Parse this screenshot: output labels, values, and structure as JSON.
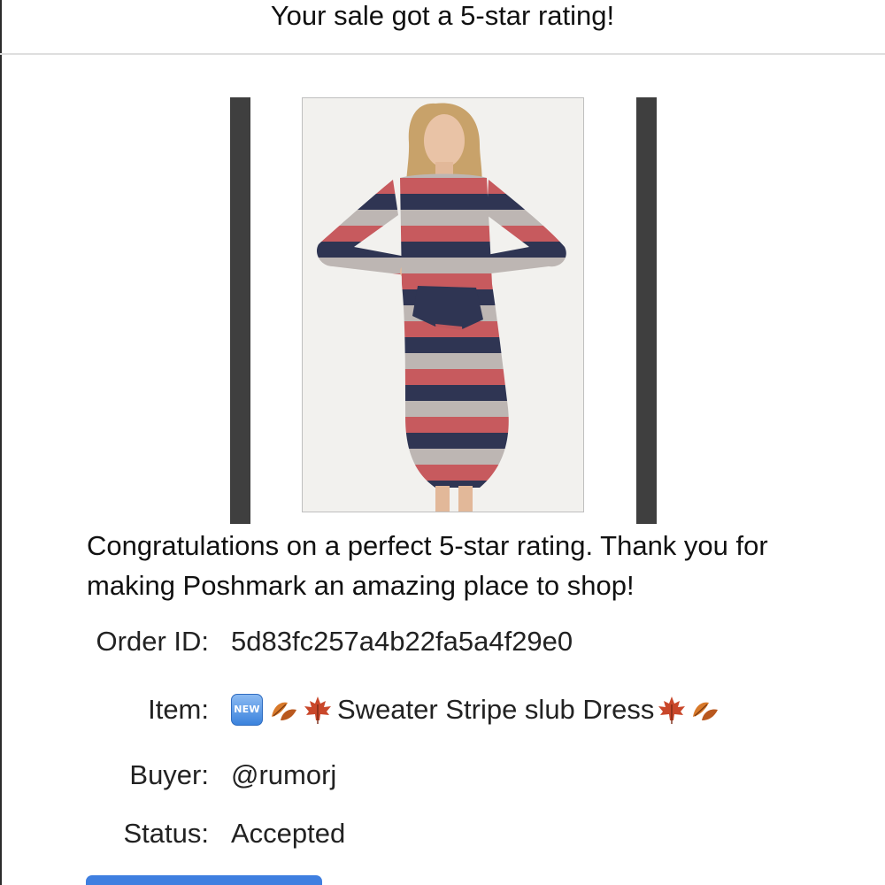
{
  "header": {
    "title": "Your sale got a 5-star rating!"
  },
  "product": {
    "image_icon": "striped-dress-photo"
  },
  "message": {
    "text": "Congratulations on a perfect 5-star rating. Thank you for making Poshmark an amazing place to shop!"
  },
  "details": {
    "order_label": "Order ID:",
    "order_value": "5d83fc257a4b22fa5a4f29e0",
    "item_label": "Item:",
    "item_badge": "NEW",
    "item_name": "Sweater Stripe slub Dress",
    "item_icons": [
      "new-badge-icon",
      "falling-leaf-icon",
      "maple-leaf-icon",
      "maple-leaf-icon",
      "falling-leaf-icon"
    ],
    "buyer_label": "Buyer:",
    "buyer_value": "@rumorj",
    "status_label": "Status:",
    "status_value": "Accepted"
  },
  "colors": {
    "accent_button": "#3f7fe0",
    "divider": "#dedede",
    "side_bars": "#3f3f3f"
  }
}
